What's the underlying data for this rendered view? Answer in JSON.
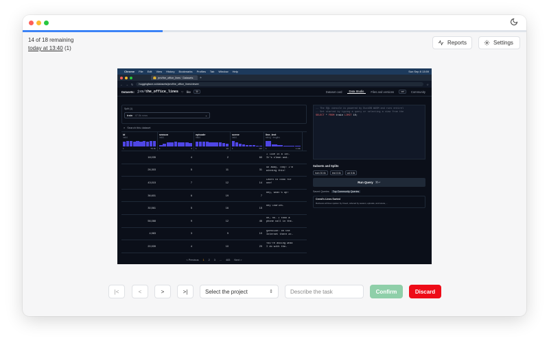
{
  "status": {
    "remaining": "14 of 18 remaining",
    "last_saved": "today at 13:40",
    "last_saved_count": "(1)",
    "progress": 0.278
  },
  "toolbar": {
    "reports": "Reports",
    "settings": "Settings"
  },
  "screenshot": {
    "menubar": {
      "items": [
        "Chrome",
        "File",
        "Edit",
        "View",
        "History",
        "Bookmarks",
        "Profiles",
        "Tab",
        "Window",
        "Help"
      ],
      "clock": "Sun Sep 8 13:59"
    },
    "tab_title": "jxm/the_office_lines · Datasets",
    "url": "huggingface.co/datasets/jxm/the_office_lines/viewer",
    "nav": {
      "prefix": "Datasets:",
      "owner": "jxm/",
      "name": "the_office_lines",
      "like": "like",
      "likes": "30",
      "tabs": [
        "Dataset card",
        "Data Studio",
        "Files and versions",
        "Community"
      ],
      "xet": "xet"
    },
    "split": {
      "label": "Split (1)",
      "value": "train",
      "rows": "· 47.5k rows"
    },
    "search_placeholder": "Search this dataset",
    "columns": [
      {
        "name": "id",
        "type": "int64",
        "min": "1",
        "max": "59.9k"
      },
      {
        "name": "season",
        "type": "int64",
        "min": "1",
        "max": "9"
      },
      {
        "name": "episode",
        "type": "int64",
        "min": "1",
        "max": "26"
      },
      {
        "name": "scene",
        "type": "int64",
        "min": "1",
        "max": "116"
      },
      {
        "name": "line_text",
        "type": "string · lengths",
        "min": "1",
        "max": "1.44k"
      }
    ],
    "rows": [
      [
        "18,035",
        "4",
        "2",
        "60",
        "I like it a lot.\nIt's clean and…"
      ],
      [
        "26,303",
        "5",
        "11",
        "31",
        "Go away, Toby! I'm\nwinning this!"
      ],
      [
        "43,015",
        "7",
        "12",
        "14",
        "Learn to cook for\none!"
      ],
      [
        "36,601",
        "6",
        "19",
        "7",
        "Hey, what's up?"
      ],
      [
        "30,561",
        "5",
        "16",
        "15",
        "Hey Charles."
      ],
      [
        "56,088",
        "9",
        "12",
        "46",
        "Oh, no. I took a\nphone call in the…"
      ],
      [
        "4,983",
        "3",
        "9",
        "10",
        "Question: on the\nInternet there ar…"
      ],
      [
        "20,939",
        "4",
        "10",
        "29",
        "You're asking what\nI do with the…"
      ]
    ],
    "pager": [
      "< Previous",
      "1",
      "2",
      "3",
      "...",
      "483",
      "Next >"
    ],
    "sql_comments": [
      "-- The SQL console is powered by DuckDB WASM and runs entirel",
      "-- Get started by typing a query or selecting a view from the"
    ],
    "sql": {
      "select": "SELECT",
      "star": " * ",
      "from": "FROM",
      "table": " train ",
      "limit": "LIMIT",
      "n": " 10;"
    },
    "subsets_title": "Subsets and Splits",
    "chips": [
      "train 30.6k",
      "test 8.6k",
      "val 8.6k"
    ],
    "run_query": "Run Query",
    "run_shortcut": "⌘↵",
    "query_tabs": [
      "Saved Queries",
      "Top Community Queries"
    ],
    "query_card": {
      "title": "Creed's Lines Sorted",
      "desc": "Retrieves all lines spoken by Creed, ordered by season, episode, and scene,…"
    }
  },
  "controls": {
    "first": "|<",
    "prev": "<",
    "next": ">",
    "last": ">|",
    "project_placeholder": "Select the project",
    "task_placeholder": "Describe the task",
    "confirm": "Confirm",
    "discard": "Discard"
  },
  "colors": {
    "accent": "#3b82f6",
    "confirm": "#8fcfa9",
    "discard": "#ee0c18"
  }
}
